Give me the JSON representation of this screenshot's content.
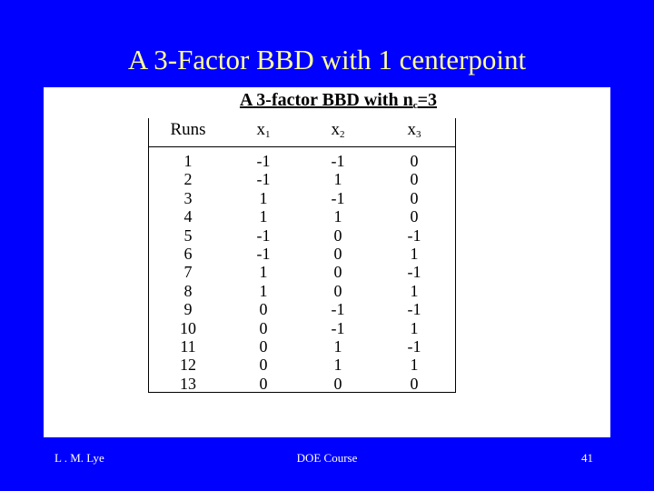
{
  "slide": {
    "title": "A 3-Factor BBD with 1 centerpoint",
    "background_color": "#0000ff",
    "title_color": "#ffff99"
  },
  "table": {
    "title_main": "A 3-factor BBD with n",
    "title_sub": "c",
    "title_tail": "=3",
    "headers": [
      {
        "base": "Runs",
        "sub": ""
      },
      {
        "base": "x",
        "sub": "1"
      },
      {
        "base": "x",
        "sub": "2"
      },
      {
        "base": "x",
        "sub": "3"
      }
    ],
    "rows": [
      [
        "1",
        "-1",
        "-1",
        "0"
      ],
      [
        "2",
        "-1",
        "1",
        "0"
      ],
      [
        "3",
        "1",
        "-1",
        "0"
      ],
      [
        "4",
        "1",
        "1",
        "0"
      ],
      [
        "5",
        "-1",
        "0",
        "-1"
      ],
      [
        "6",
        "-1",
        "0",
        "1"
      ],
      [
        "7",
        "1",
        "0",
        "-1"
      ],
      [
        "8",
        "1",
        "0",
        "1"
      ],
      [
        "9",
        "0",
        "-1",
        "-1"
      ],
      [
        "10",
        "0",
        "-1",
        "1"
      ],
      [
        "11",
        "0",
        "1",
        "-1"
      ],
      [
        "12",
        "0",
        "1",
        "1"
      ],
      [
        "13",
        "0",
        "0",
        "0"
      ]
    ]
  },
  "footer": {
    "author": "L . M. Lye",
    "course": "DOE Course",
    "page_number": "41"
  }
}
